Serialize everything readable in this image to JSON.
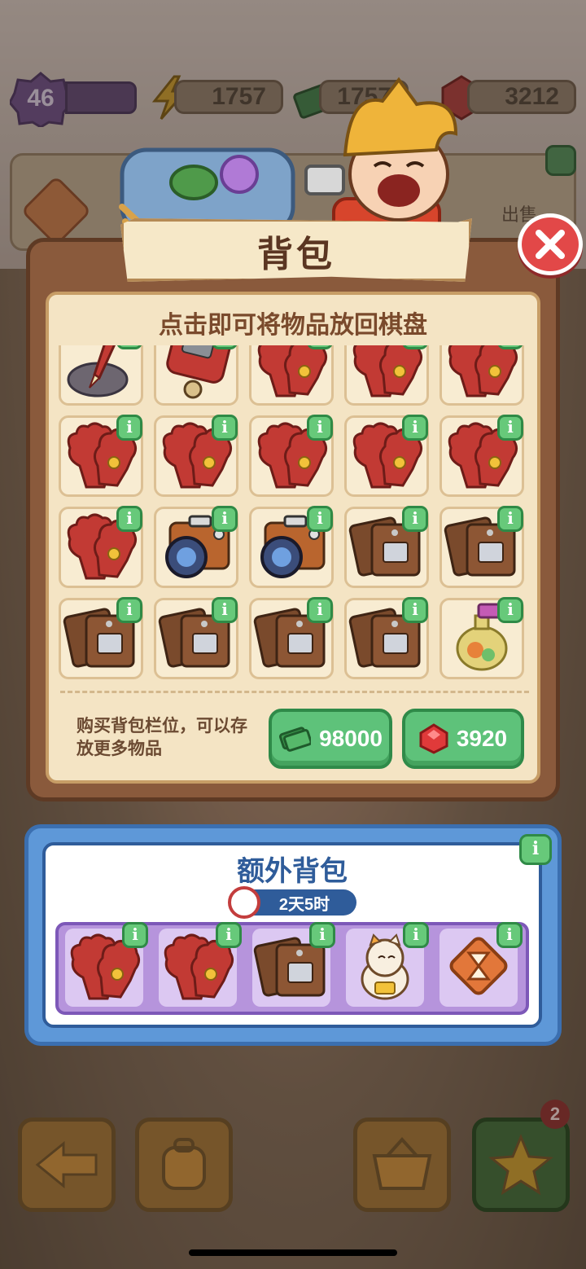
{
  "hud": {
    "level": "46",
    "energy": "1757",
    "cash": "1757",
    "gems": "3212"
  },
  "modal": {
    "title": "背包",
    "subtitle": "点击即可将物品放回棋盘",
    "buy_text": "购买背包栏位，可以存放更多物品",
    "price_cash": "98000",
    "price_gems": "3920",
    "slots": [
      "trowel-icon",
      "suitcase-icon",
      "glove-icon",
      "glove-icon",
      "glove-icon",
      "glove-icon",
      "glove-icon",
      "glove-icon",
      "glove-icon",
      "glove-icon",
      "glove-icon",
      "camera-icon",
      "camera-icon",
      "leather-pouch-icon",
      "leather-pouch-icon",
      "leather-pouch-icon",
      "leather-pouch-icon",
      "leather-pouch-icon",
      "leather-pouch-icon",
      "perfume-bottle-icon"
    ],
    "info_glyph": "i"
  },
  "extra": {
    "title": "额外背包",
    "timer": "2天5时",
    "slots": [
      "glove-icon",
      "glove-icon",
      "leather-pouch-icon",
      "lucky-cat-icon",
      "hourglass-tile-icon"
    ]
  },
  "background": {
    "bubble_text": "出售",
    "badge": "2"
  },
  "colors": {
    "brown_frame": "#8a5a3c",
    "parchment": "#f4e4c4",
    "green_button": "#5ec27a",
    "blue_panel": "#5e98d8",
    "purple_strip": "#b694dc",
    "close_red": "#e24848"
  }
}
